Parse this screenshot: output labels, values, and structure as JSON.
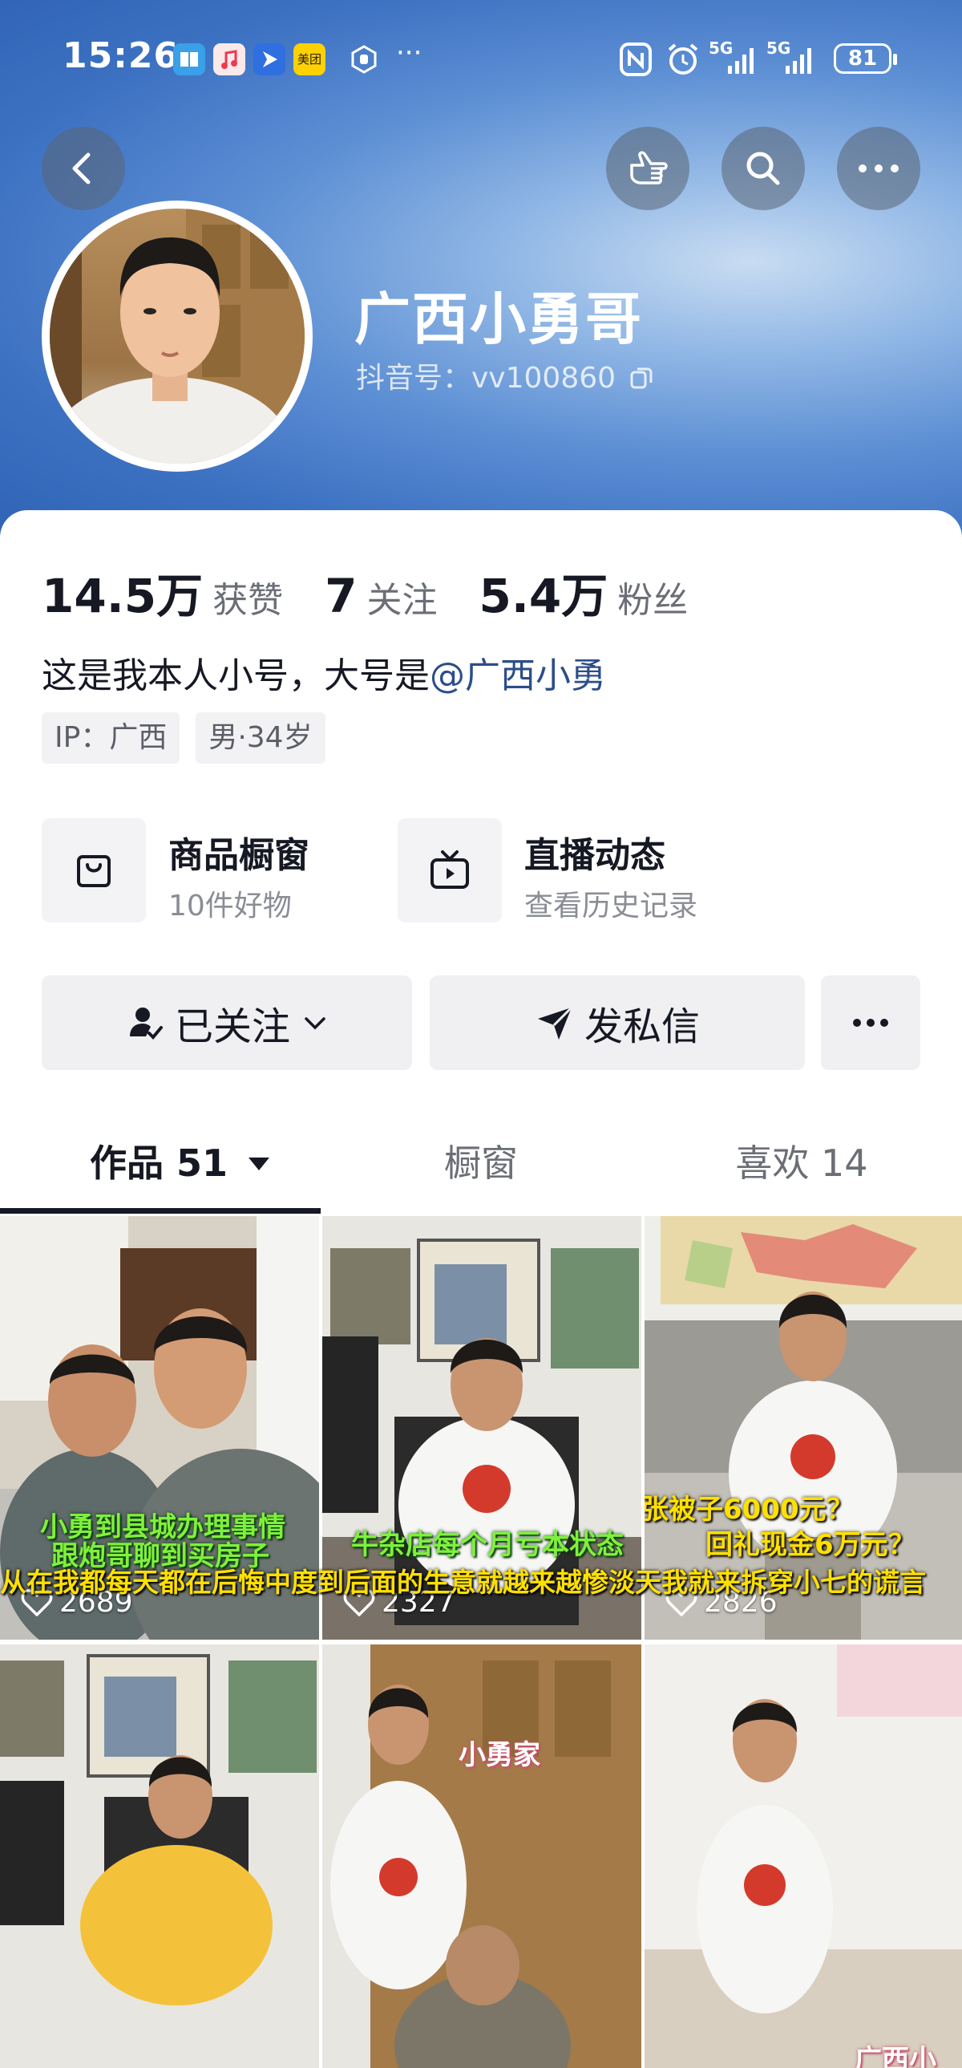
{
  "status_bar": {
    "time": "15:26",
    "app_icons": [
      "book-app-icon",
      "music-app-icon",
      "navigation-app-icon",
      "meituan-app-icon",
      "hand-app-icon"
    ],
    "meituan_label": "美团",
    "more": "···",
    "signal_label_1": "5G",
    "signal_label_2": "5G",
    "battery": "81"
  },
  "header": {
    "back_icon": "chevron-left-icon",
    "action_icons": [
      "pointing-hand-icon",
      "search-icon",
      "more-icon"
    ]
  },
  "profile": {
    "name": "广西小勇哥",
    "douyin_id": "抖音号：vv100860",
    "copy_icon": "copy-icon"
  },
  "stats": [
    {
      "value": "14.5万",
      "label": "获赞"
    },
    {
      "value": "7",
      "label": "关注"
    },
    {
      "value": "5.4万",
      "label": "粉丝"
    }
  ],
  "bio": {
    "text": "这是我本人小号，大号是",
    "mention": "@广西小勇"
  },
  "tags": [
    "IP：广西",
    "男·34岁"
  ],
  "features": [
    {
      "title": "商品橱窗",
      "subtitle": "10件好物",
      "icon": "shopping-bag-icon"
    },
    {
      "title": "直播动态",
      "subtitle": "查看历史记录",
      "icon": "tv-icon"
    }
  ],
  "actions": {
    "follow_label": "已关注",
    "message_label": "发私信",
    "more_icon": "more-icon"
  },
  "tabs": [
    {
      "label": "作品 51",
      "active": true
    },
    {
      "label": "橱窗",
      "active": false
    },
    {
      "label": "喜欢 14",
      "active": false
    }
  ],
  "videos": [
    {
      "likes": "2689",
      "caption_1": "小勇到县城办理事情",
      "caption_2": "跟炮哥聊到买房子"
    },
    {
      "likes": "2327",
      "caption_1": "牛杂店每个月亏本状态"
    },
    {
      "likes": "2826",
      "caption_1": "张被子6000元？",
      "caption_2": "回礼现金6万元？"
    },
    {
      "likes": ""
    },
    {
      "likes": "",
      "caption_1": "小勇家"
    },
    {
      "likes": "",
      "caption_1": "广西小"
    }
  ],
  "ticker": "从在我都每天都在后悔中度到后面的生意就越来越惨淡天我就来拆穿小七的谎言"
}
